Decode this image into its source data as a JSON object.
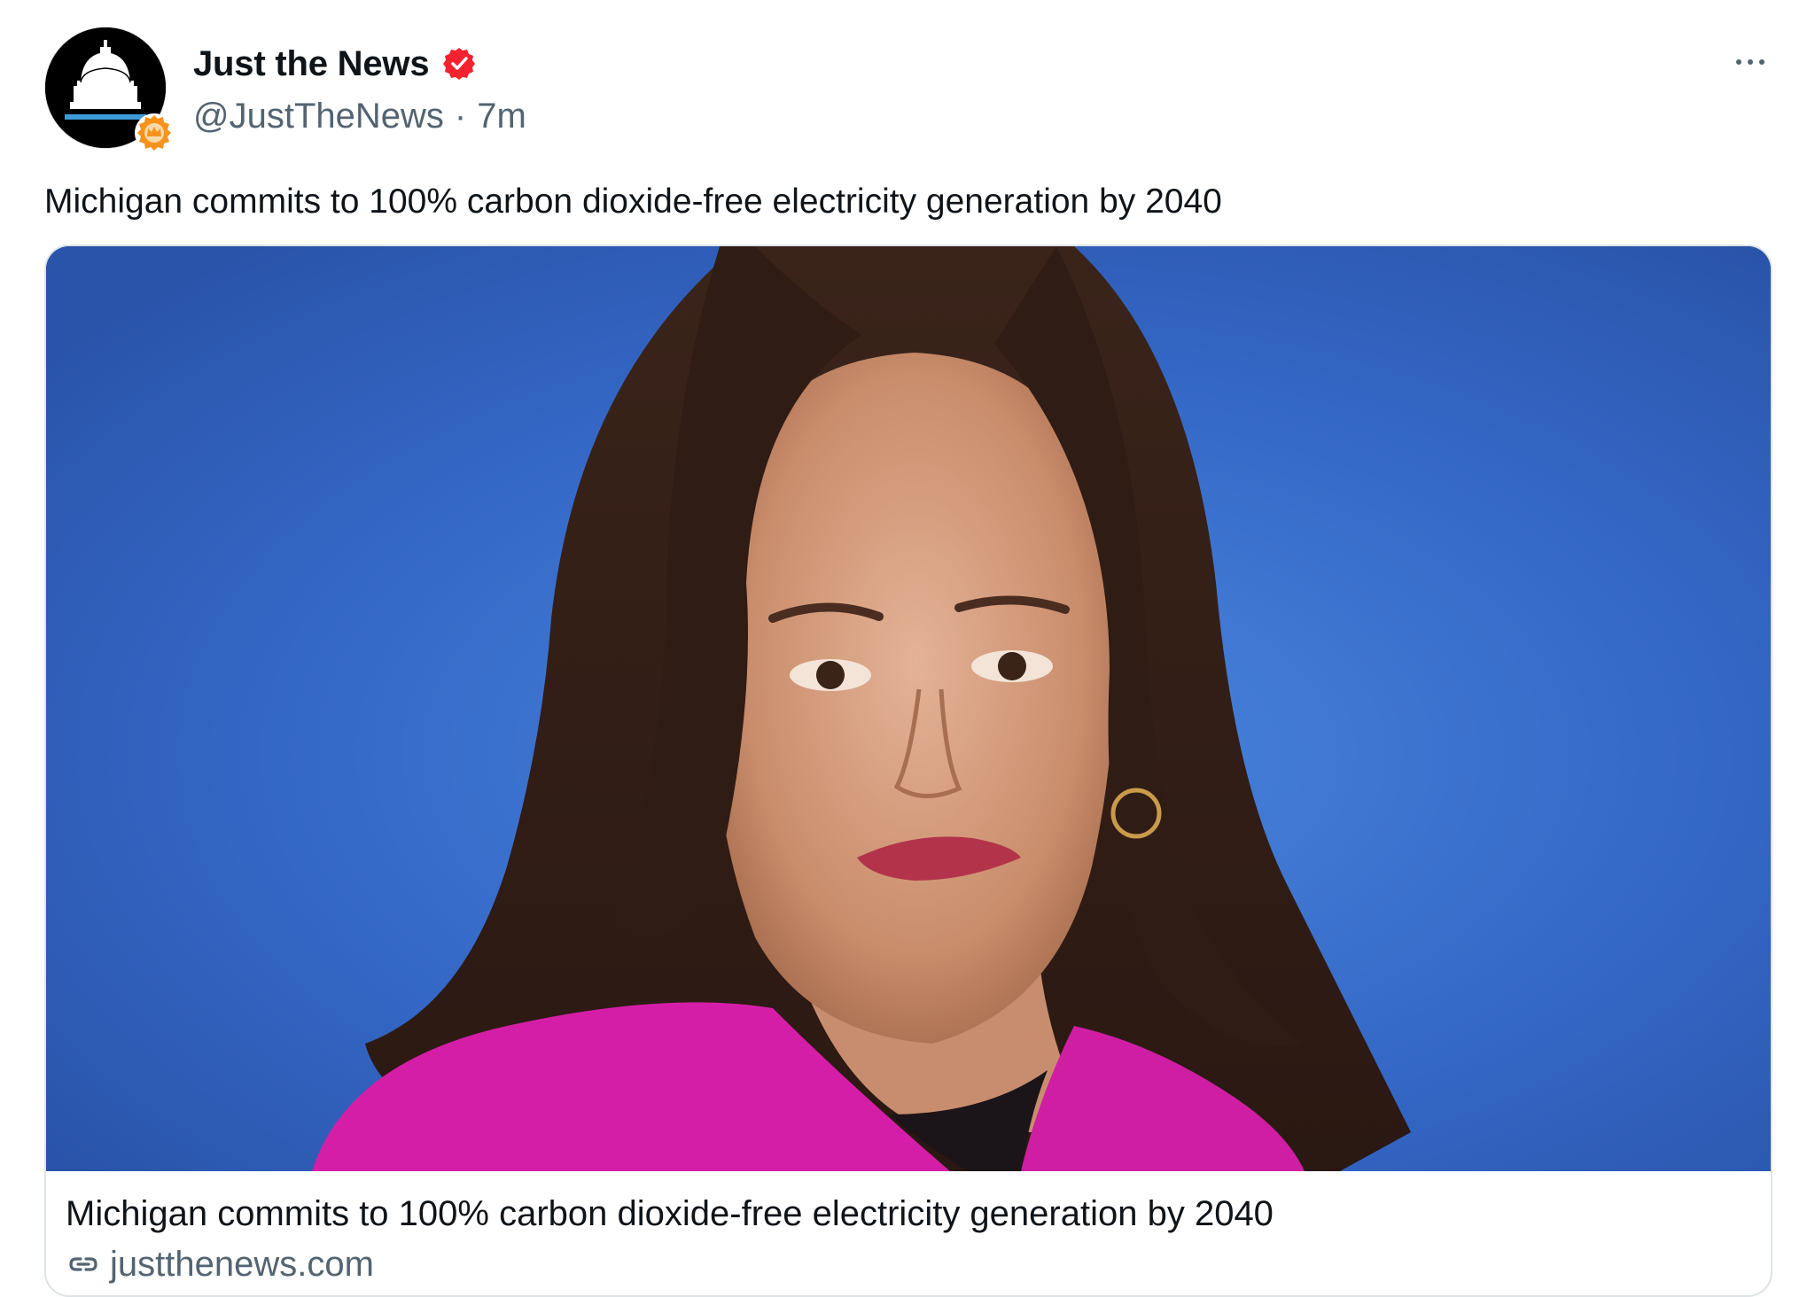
{
  "post": {
    "author": {
      "display_name": "Just the News",
      "handle": "@JustTheNews",
      "separator": "·",
      "timestamp": "7m",
      "verified": true,
      "avatar_icon": "capitol-dome-icon",
      "affiliate_badge_icon": "crown-badge-icon"
    },
    "text": "Michigan commits to 100% carbon dioxide-free electricity generation by 2040",
    "more_icon": "more-horizontal-icon"
  },
  "link_card": {
    "image_icon": "woman-portrait-photo",
    "title": "Michigan commits to 100% carbon dioxide-free electricity generation by 2040",
    "domain": "justthenews.com",
    "link_icon": "link-icon"
  },
  "colors": {
    "text_primary": "#0f1419",
    "text_secondary": "#536471",
    "verified_red": "#f4212e",
    "affiliate_orange": "#f7931a",
    "card_border": "#dfe3e6",
    "photo_background_blue": "#3366c4",
    "jacket_pink": "#d51ea8"
  }
}
